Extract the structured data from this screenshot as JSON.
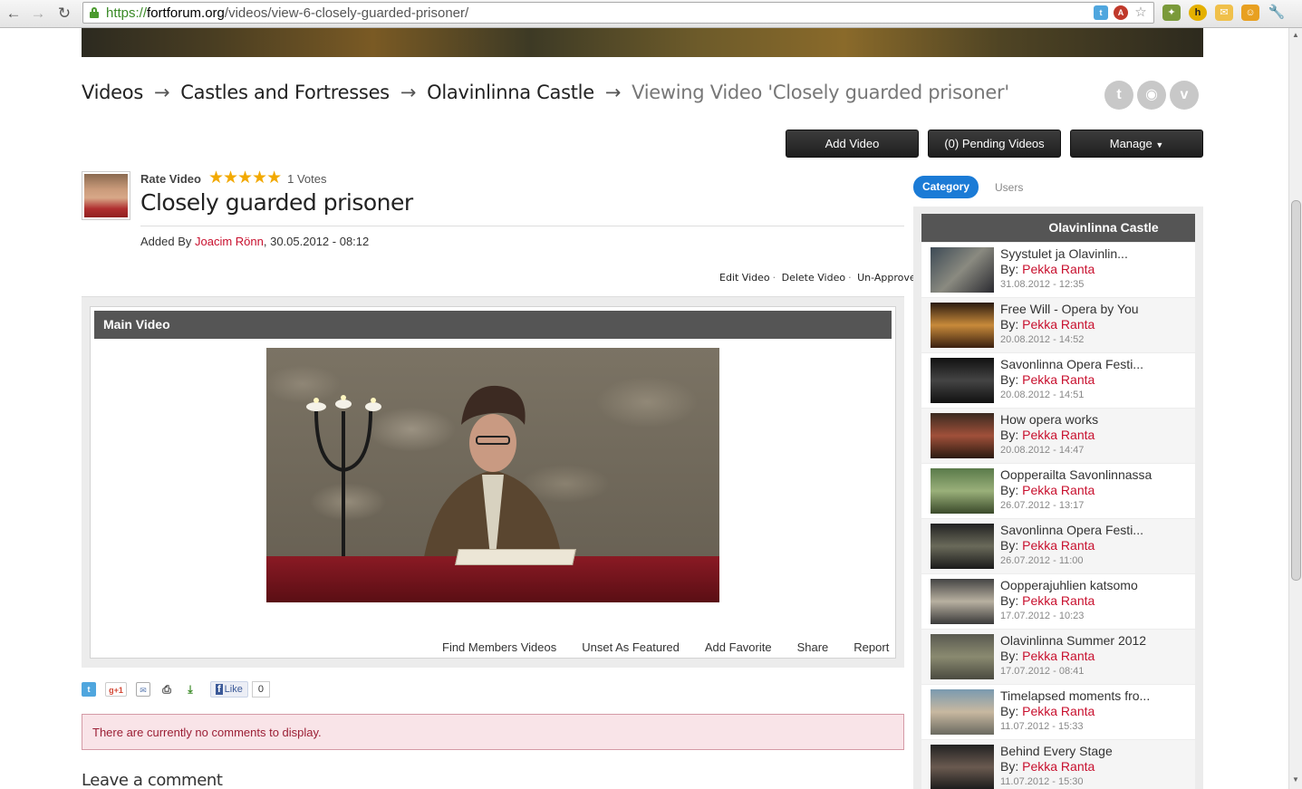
{
  "browser": {
    "url_scheme": "https://",
    "url_host": "fortforum.org",
    "url_path": "/videos/view-6-closely-guarded-prisoner/"
  },
  "breadcrumb": {
    "items": [
      "Videos",
      "Castles and Fortresses",
      "Olavinlinna Castle"
    ],
    "separator": "→",
    "current": "Viewing Video 'Closely guarded prisoner'"
  },
  "social": {
    "twitter": "t",
    "rss": "◉",
    "vimeo": "v"
  },
  "actions": {
    "add_video": "Add Video",
    "pending_videos": "(0) Pending Videos",
    "manage": "Manage"
  },
  "video": {
    "rate_label": "Rate Video",
    "stars": "★★★★★",
    "votes": "1 Votes",
    "title": "Closely guarded prisoner",
    "added_by_prefix": "Added By ",
    "author": "Joacim Rönn",
    "date": ", 30.05.2012 - 08:12",
    "edit_links": [
      "Edit Video",
      "Delete Video",
      "Un-Approve"
    ],
    "panel_title": "Main Video",
    "links": [
      "Find Members Videos",
      "Unset As Featured",
      "Add Favorite",
      "Share",
      "Report"
    ]
  },
  "share": {
    "like_label": "Like",
    "like_count": "0"
  },
  "comments": {
    "empty": "There are currently no comments to display.",
    "leave": "Leave a comment"
  },
  "sidebar": {
    "tabs": [
      "Category",
      "Users"
    ],
    "heading": "Olavinlinna Castle",
    "by_prefix": "By: ",
    "items": [
      {
        "title": "Syystulet ja Olavinlin...",
        "author": "Pekka Ranta",
        "date": "31.08.2012 - 12:35"
      },
      {
        "title": "Free Will - Opera by You",
        "author": "Pekka Ranta",
        "date": "20.08.2012 - 14:52"
      },
      {
        "title": "Savonlinna Opera Festi...",
        "author": "Pekka Ranta",
        "date": "20.08.2012 - 14:51"
      },
      {
        "title": "How opera works",
        "author": "Pekka Ranta",
        "date": "20.08.2012 - 14:47"
      },
      {
        "title": "Oopperailta Savonlinnassa",
        "author": "Pekka Ranta",
        "date": "26.07.2012 - 13:17"
      },
      {
        "title": "Savonlinna Opera Festi...",
        "author": "Pekka Ranta",
        "date": "26.07.2012 - 11:00"
      },
      {
        "title": "Oopperajuhlien katsomo",
        "author": "Pekka Ranta",
        "date": "17.07.2012 - 10:23"
      },
      {
        "title": "Olavinlinna Summer 2012",
        "author": "Pekka Ranta",
        "date": "17.07.2012 - 08:41"
      },
      {
        "title": "Timelapsed moments fro...",
        "author": "Pekka Ranta",
        "date": "11.07.2012 - 15:33"
      },
      {
        "title": "Behind Every Stage",
        "author": "Pekka Ranta",
        "date": "11.07.2012 - 15:30"
      }
    ]
  },
  "colors": {
    "accent_red": "#c8102e",
    "tab_blue": "#1b7bd6",
    "panel_header": "#555555"
  }
}
